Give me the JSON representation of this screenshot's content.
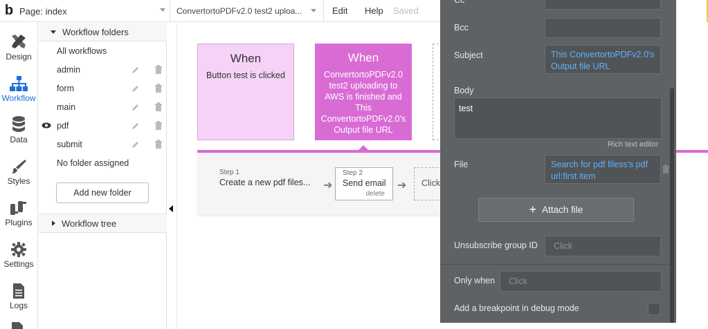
{
  "topbar": {
    "logo": "b",
    "page_select": "Page: index",
    "workflow_select": "ConvertortoPDFv2.0 test2 uploa...",
    "edit_label": "Edit",
    "help_label": "Help",
    "saved_label": "Saved"
  },
  "rail": {
    "items": [
      {
        "label": "Design",
        "icon": "design-icon"
      },
      {
        "label": "Workflow",
        "icon": "workflow-icon"
      },
      {
        "label": "Data",
        "icon": "database-icon"
      },
      {
        "label": "Styles",
        "icon": "brush-icon"
      },
      {
        "label": "Plugins",
        "icon": "plug-icon"
      },
      {
        "label": "Settings",
        "icon": "gear-icon"
      },
      {
        "label": "Logs",
        "icon": "document-icon"
      }
    ]
  },
  "folders": {
    "header": "Workflow folders",
    "items": [
      {
        "label": "All workflows"
      },
      {
        "label": "admin"
      },
      {
        "label": "form"
      },
      {
        "label": "main"
      },
      {
        "label": "pdf"
      },
      {
        "label": "submit"
      },
      {
        "label": "No folder assigned"
      }
    ],
    "add_button": "Add new folder",
    "tree_header": "Workflow tree"
  },
  "canvas": {
    "event1": {
      "title": "When",
      "desc": "Button test is clicked"
    },
    "event2": {
      "title": "When",
      "desc": "ConvertortoPDFv2.0 test2 uploading to AWS is finished and This ConvertortoPDFv2.0's Output file URL"
    },
    "step1": {
      "sub": "Step 1",
      "name": "Create a new pdf files..."
    },
    "step2": {
      "sub": "Step 2",
      "name": "Send email",
      "delete": "delete"
    },
    "step3": {
      "name": "Click"
    }
  },
  "editor": {
    "cc_label": "Cc",
    "bcc_label": "Bcc",
    "subject_label": "Subject",
    "subject_value": "This ConvertortoPDFv2.0's Output file URL",
    "body_label": "Body",
    "body_value": "test",
    "rich_text": "Rich text editor",
    "file_label": "File",
    "file_value": "Search for pdf filess's pdf url:first item",
    "attach_label": "Attach file",
    "unsub_label": "Unsubscribe group ID",
    "unsub_placeholder": "Click",
    "only_when_label": "Only when",
    "only_when_placeholder": "Click",
    "breakpoint_label": "Add a breakpoint in debug mode"
  },
  "colors": {
    "accent": "#1e6fd9",
    "event_light": "#f6d2f8",
    "event_active": "#d96bd4",
    "editor_bg": "#5f6265",
    "dynamic_text": "#5fb0ff"
  }
}
